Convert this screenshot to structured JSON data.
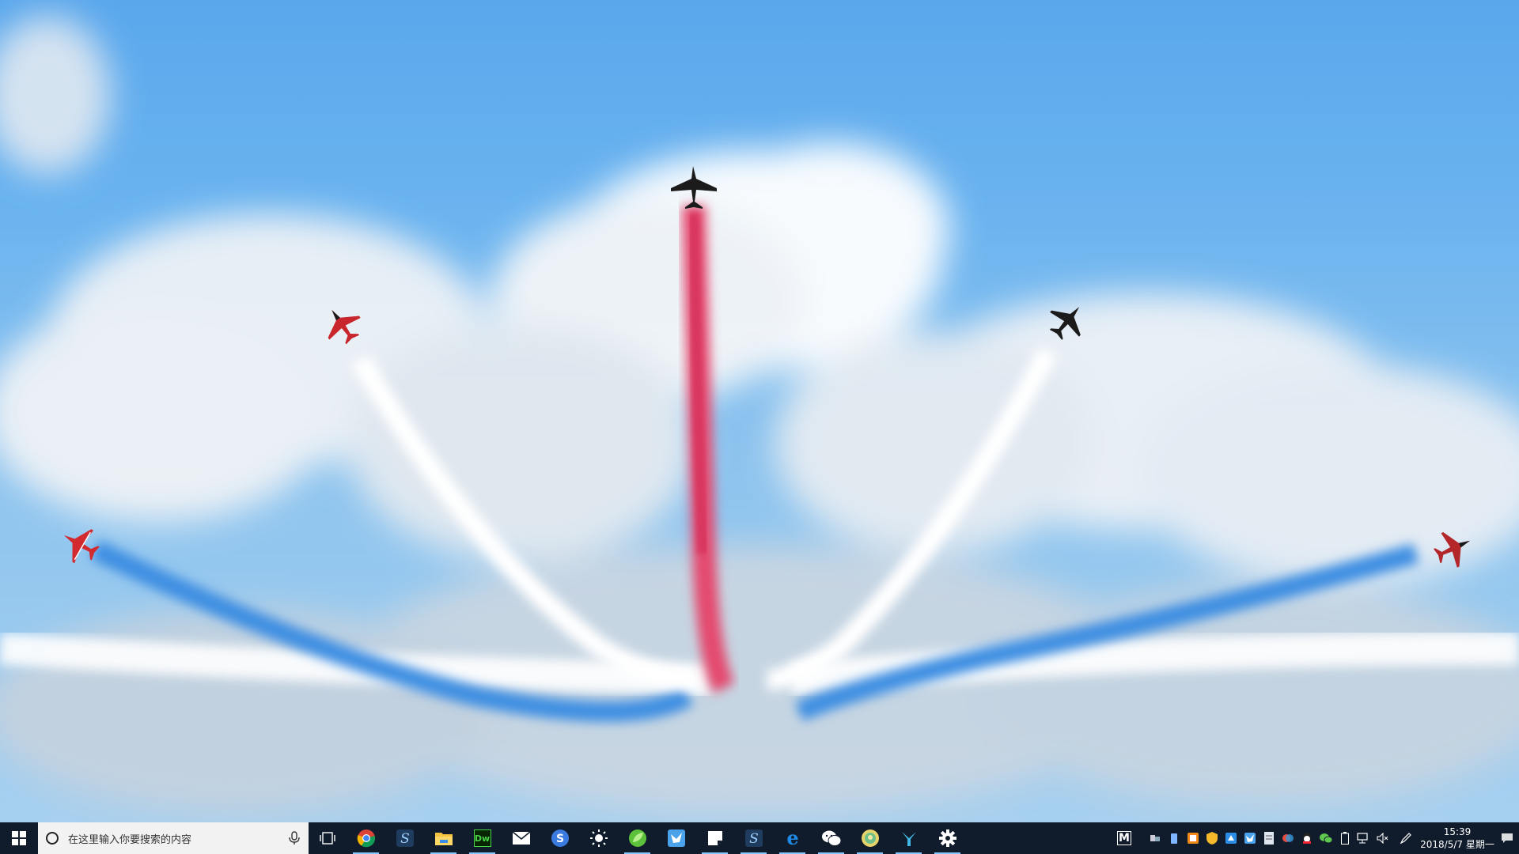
{
  "taskbar": {
    "search_placeholder": "在这里输入你要搜索的内容",
    "tray_label": "M",
    "clock_time": "15:39",
    "clock_date": "2018/5/7 星期一",
    "apps": [
      {
        "name": "chrome",
        "active": true
      },
      {
        "name": "sublime-s",
        "active": false
      },
      {
        "name": "file-explorer",
        "active": true
      },
      {
        "name": "dreamweaver",
        "active": true,
        "label": "Dw"
      },
      {
        "name": "mail",
        "active": false
      },
      {
        "name": "sogou-browser",
        "active": false
      },
      {
        "name": "brightness",
        "active": false
      },
      {
        "name": "leaf-app",
        "active": true
      },
      {
        "name": "bird-app",
        "active": false
      },
      {
        "name": "notes",
        "active": true
      },
      {
        "name": "sublime-s-2",
        "active": true
      },
      {
        "name": "edge",
        "active": true
      },
      {
        "name": "wechat",
        "active": true
      },
      {
        "name": "map-app",
        "active": true
      },
      {
        "name": "y-app",
        "active": true
      },
      {
        "name": "settings",
        "active": true
      }
    ],
    "colors": {
      "taskbar_bg": "#101c2b",
      "active_underline": "#86c7ff",
      "search_bg": "#f2f2f2"
    }
  },
  "wallpaper": {
    "subject": "aerobatic jets with red white blue smoke trails",
    "sky_color": "#6ab3ef"
  }
}
